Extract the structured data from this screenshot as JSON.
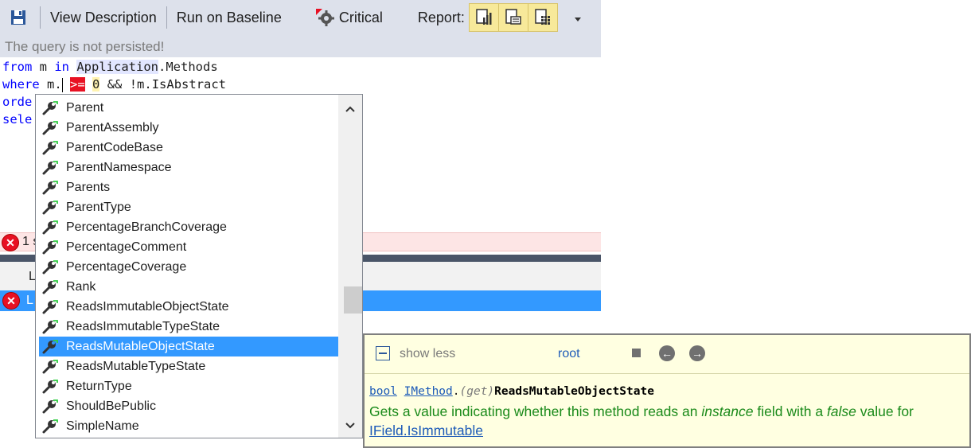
{
  "toolbar": {
    "view_description": "View Description",
    "run_on_baseline": "Run on Baseline",
    "critical": "Critical",
    "report": "Report:"
  },
  "notice": "The query is not persisted!",
  "editor": {
    "line1": {
      "kw1": "from",
      "t1": " m ",
      "kw2": "in",
      "t2": " ",
      "app": "Application",
      "t3": ".Methods"
    },
    "line2": {
      "kw1": "where",
      "t1": " m.",
      "op": ">=",
      "t2": " ",
      "num": "0",
      "t3": " && !m.IsAbstract"
    },
    "line3": "orde",
    "line4": "sele"
  },
  "error_bar": {
    "count_text": "1 s"
  },
  "grid": {
    "header_text": "L",
    "row_text": "L"
  },
  "completion": {
    "items": [
      "Parent",
      "ParentAssembly",
      "ParentCodeBase",
      "ParentNamespace",
      "Parents",
      "ParentType",
      "PercentageBranchCoverage",
      "PercentageComment",
      "PercentageCoverage",
      "Rank",
      "ReadsImmutableObjectState",
      "ReadsImmutableTypeState",
      "ReadsMutableObjectState",
      "ReadsMutableTypeState",
      "ReturnType",
      "ShouldBePublic",
      "SimpleName"
    ],
    "selected_index": 12
  },
  "tooltip": {
    "show_less": "show less",
    "root": "root",
    "signature": {
      "type": "bool",
      "owner": "IMethod",
      "dot": ".",
      "accessor": "(get)",
      "member": "ReadsMutableObjectState"
    },
    "description": {
      "p1": "Gets a value indicating whether this method reads an ",
      "em1": "instance",
      "p2": " field with a ",
      "em2": "false",
      "p3": " value for",
      "link1": "IField",
      "link_dot": ".",
      "link2": "IsImmutable"
    }
  },
  "colors": {
    "toolbar_bg": "#dde1eb",
    "selection": "#3399ff",
    "error_red": "#e81123",
    "tooltip_bg": "#ffffe1",
    "desc_green": "#1a8a1a"
  }
}
